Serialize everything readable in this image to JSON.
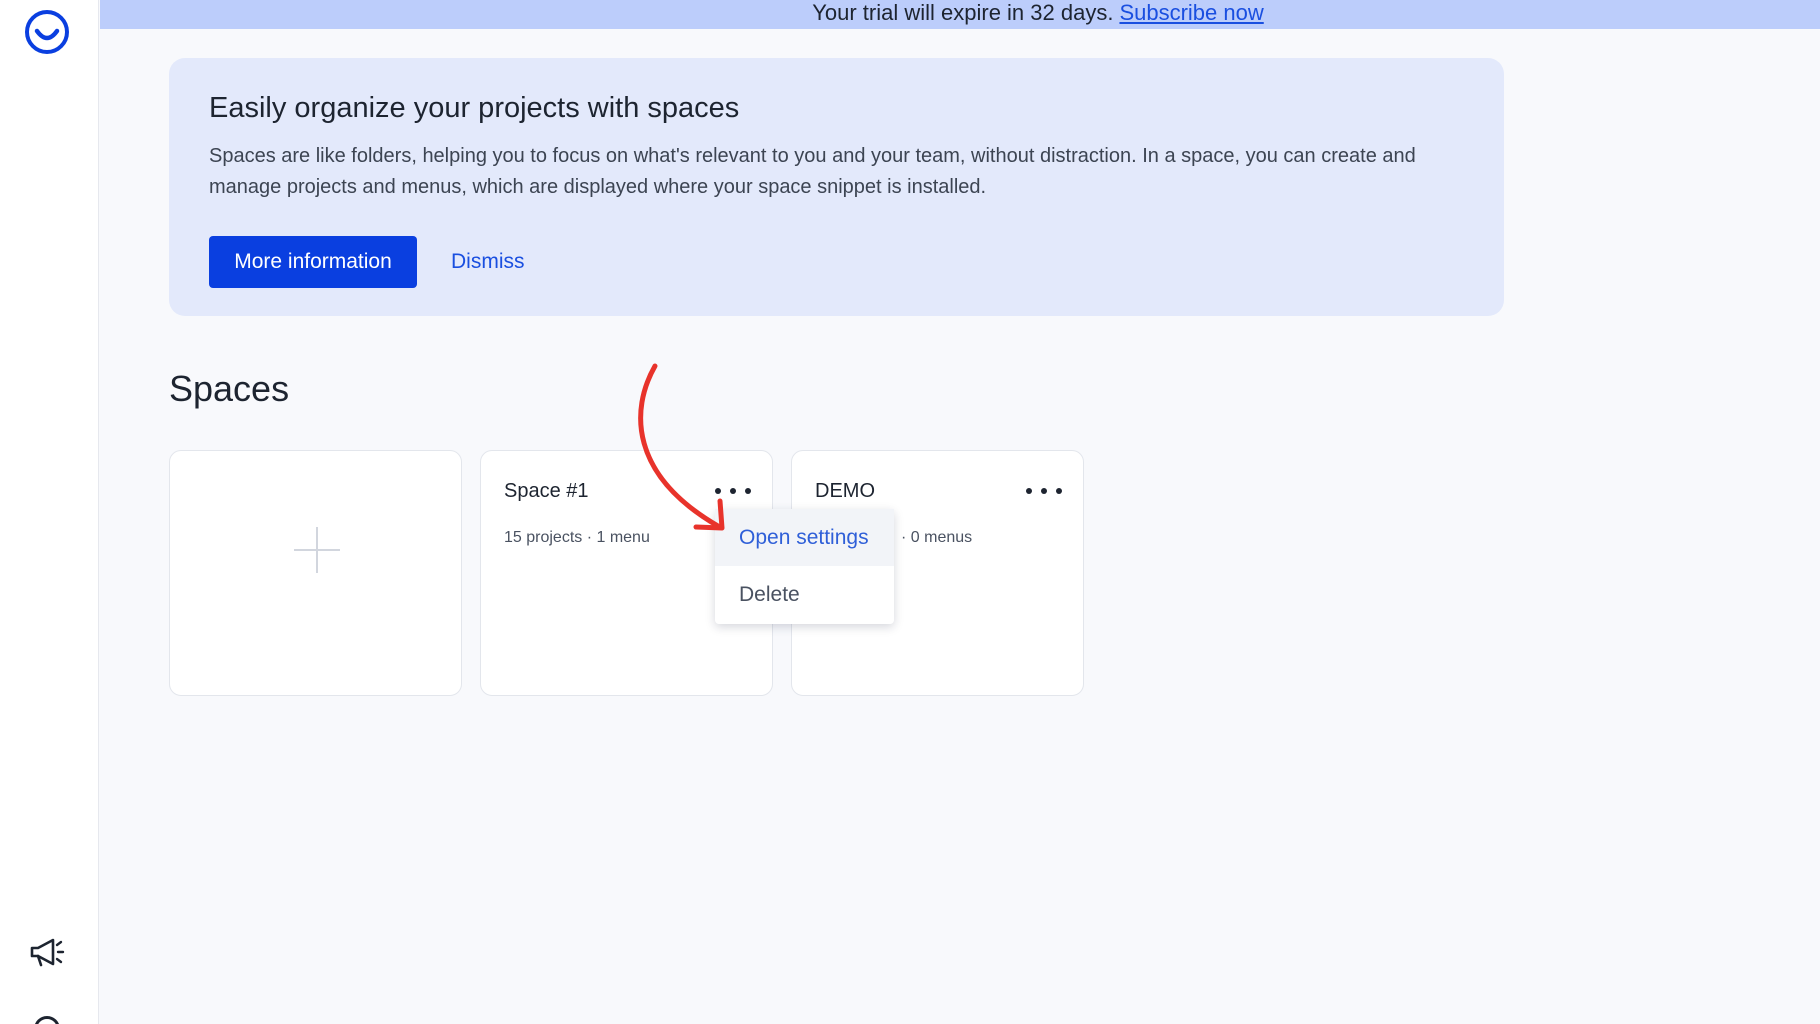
{
  "trial_banner": {
    "message": "Your trial will expire in 32 days.",
    "link": "Subscribe now"
  },
  "info_card": {
    "title": "Easily organize your projects with spaces",
    "description": "Spaces are like folders, helping you to focus on what's relevant to you and your team, without distraction. In a space, you can create and manage projects and menus, which are displayed where your space snippet is installed.",
    "primary_button": "More information",
    "dismiss_button": "Dismiss"
  },
  "spaces": {
    "title": "Spaces",
    "cards": [
      {
        "name": "Space #1",
        "meta": "15 projects · 1 menu"
      },
      {
        "name": "DEMO",
        "meta": "· 0 menus"
      }
    ]
  },
  "context_menu": {
    "items": [
      "Open settings",
      "Delete"
    ]
  },
  "icons": {
    "logo": "app-logo-icon",
    "announcements": "megaphone-icon",
    "add": "plus-icon",
    "more": "more-horizontal-icon"
  },
  "colors": {
    "primary": "#0a3fe0",
    "link": "#1a4fe0",
    "banner": "#bccdfb",
    "info_card": "#e3e9fb",
    "annotation": "#e8332b"
  }
}
